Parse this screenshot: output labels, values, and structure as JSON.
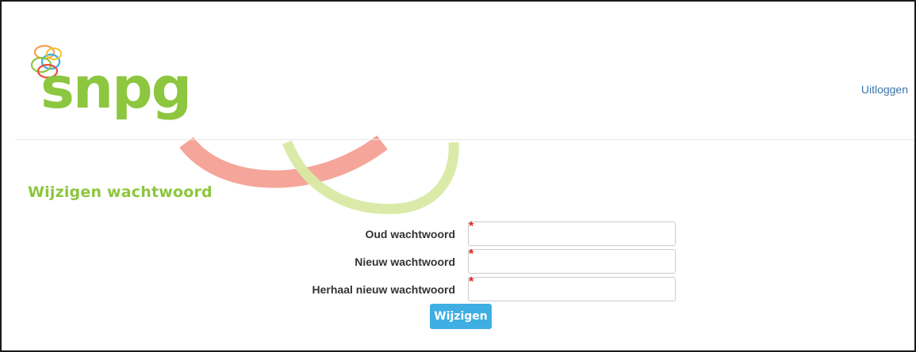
{
  "header": {
    "logo_text": "snpg",
    "logout_label": "Uitloggen"
  },
  "main": {
    "title": "Wijzigen wachtwoord",
    "form": {
      "fields": [
        {
          "label": "Oud wachtwoord",
          "value": "",
          "required_mark": "*"
        },
        {
          "label": "Nieuw wachtwoord",
          "value": "",
          "required_mark": "*"
        },
        {
          "label": "Herhaal nieuw wachtwoord",
          "value": "",
          "required_mark": "*"
        }
      ],
      "submit_label": "Wijzigen"
    }
  },
  "colors": {
    "brand_green": "#8dc63f",
    "decor_red": "#f4a093",
    "decor_lime": "#d9e9a3",
    "link_blue": "#3d75a8",
    "button_blue": "#3eaee3",
    "required_red": "#e02020"
  },
  "icons": {
    "logo_mark": "interlocking-rings-logo-icon"
  }
}
